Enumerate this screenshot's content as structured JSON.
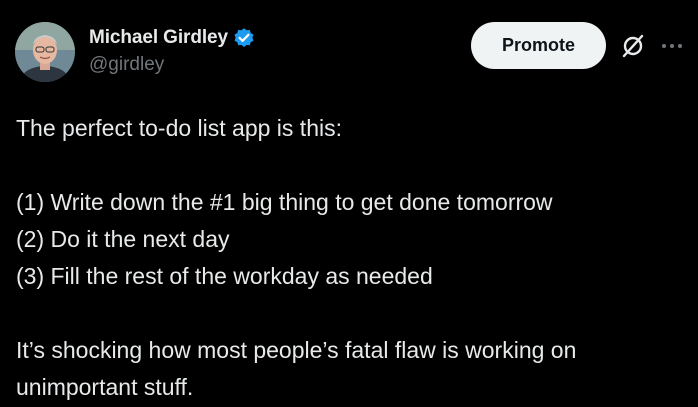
{
  "author": {
    "display_name": "Michael Girdley",
    "handle": "@girdley",
    "verified_icon": "verified-badge-icon",
    "verified_color": "#1d9bf0"
  },
  "actions": {
    "promote_label": "Promote",
    "grok_icon": "grok-slash-icon",
    "more_icon": "more-horizontal-icon"
  },
  "post": {
    "lines": [
      "The perfect to-do list app is this:",
      "(1) Write down the #1 big thing to get done tomorrow",
      "(2) Do it the next day",
      "(3) Fill the rest of the workday as needed",
      "It’s shocking how most people’s fatal flaw is working on unimportant stuff."
    ]
  },
  "colors": {
    "background": "#000000",
    "text_primary": "#e7e9ea",
    "text_secondary": "#71767b",
    "button_bg": "#eff3f4",
    "button_text": "#0f1419"
  }
}
